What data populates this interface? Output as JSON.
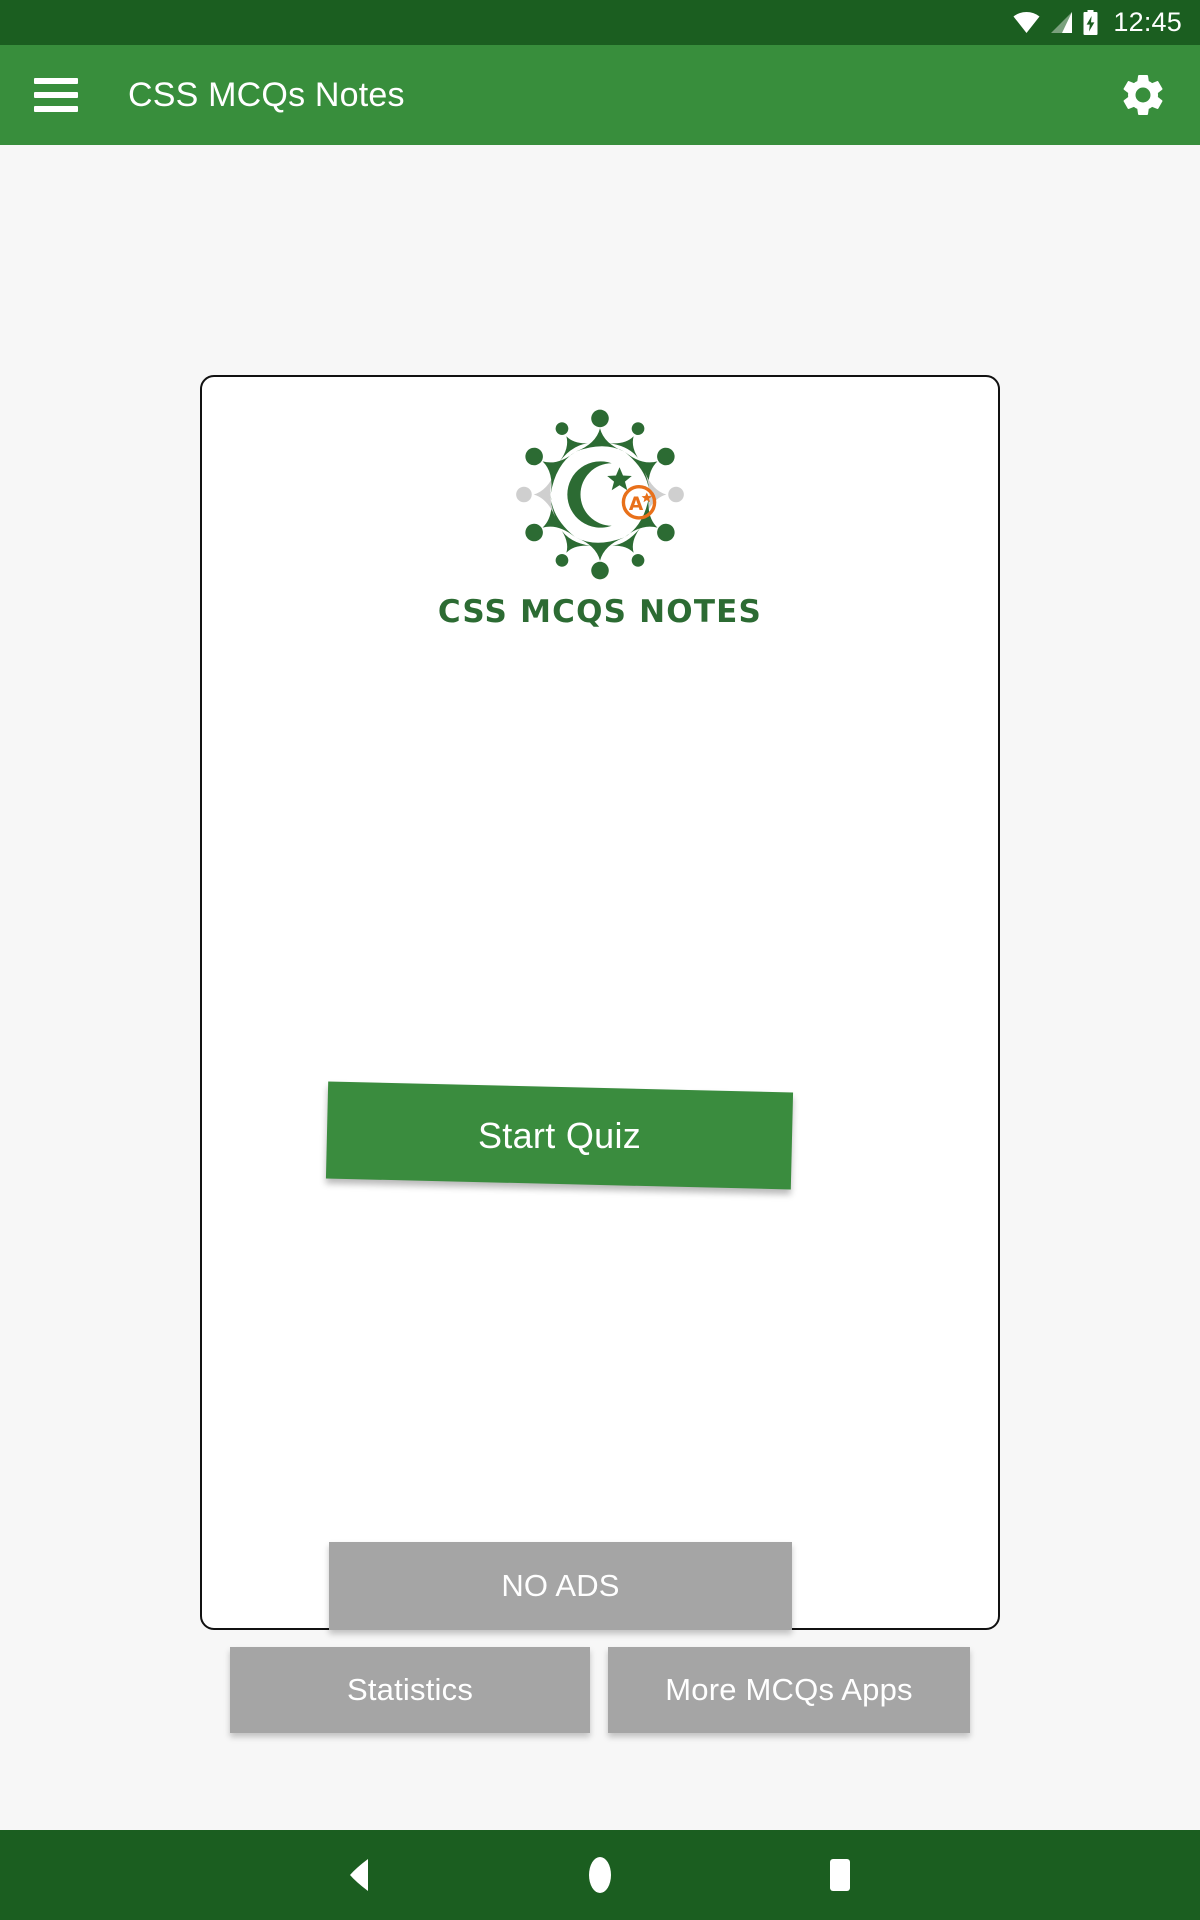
{
  "status_bar": {
    "time": "12:45",
    "wifi_icon": "wifi-icon",
    "signal_icon": "cell-signal-icon",
    "battery_icon": "battery-charging-icon",
    "background_color": "#1b5e20"
  },
  "app_bar": {
    "title": "CSS MCQs Notes",
    "menu_icon": "hamburger-menu-icon",
    "settings_icon": "gear-icon",
    "background_color": "#388e3c",
    "text_color": "#ffffff"
  },
  "card": {
    "logo": {
      "alt_name": "css-mcqs-notes-logo",
      "caption": "CSS MCQS NOTES",
      "caption_color": "#2c6b33",
      "figure_color": "#2c6b33",
      "accent_grey": "#cfcfcf",
      "badge_text": "A",
      "badge_color": "#e8701a",
      "crescent_icon": "crescent-star-icon"
    },
    "primary_button": {
      "label": "Start Quiz",
      "color": "#3a8c3e",
      "text_color": "#ffffff"
    },
    "secondary_buttons": [
      {
        "label": "NO ADS",
        "name": "no-ads-button",
        "color": "#a5a5a5"
      },
      {
        "label": "Statistics",
        "name": "statistics-button",
        "color": "#a5a5a5"
      },
      {
        "label": "More MCQs Apps",
        "name": "more-mcqs-apps-button",
        "color": "#a5a5a5"
      }
    ],
    "background_color": "#ffffff",
    "border_color": "#111111"
  },
  "nav_bar": {
    "background_color": "#1b5e20",
    "buttons": [
      {
        "name": "back-button",
        "icon": "triangle-back-icon"
      },
      {
        "name": "home-button",
        "icon": "circle-home-icon"
      },
      {
        "name": "recents-button",
        "icon": "square-recents-icon"
      }
    ]
  },
  "page_background": "#f7f7f7"
}
